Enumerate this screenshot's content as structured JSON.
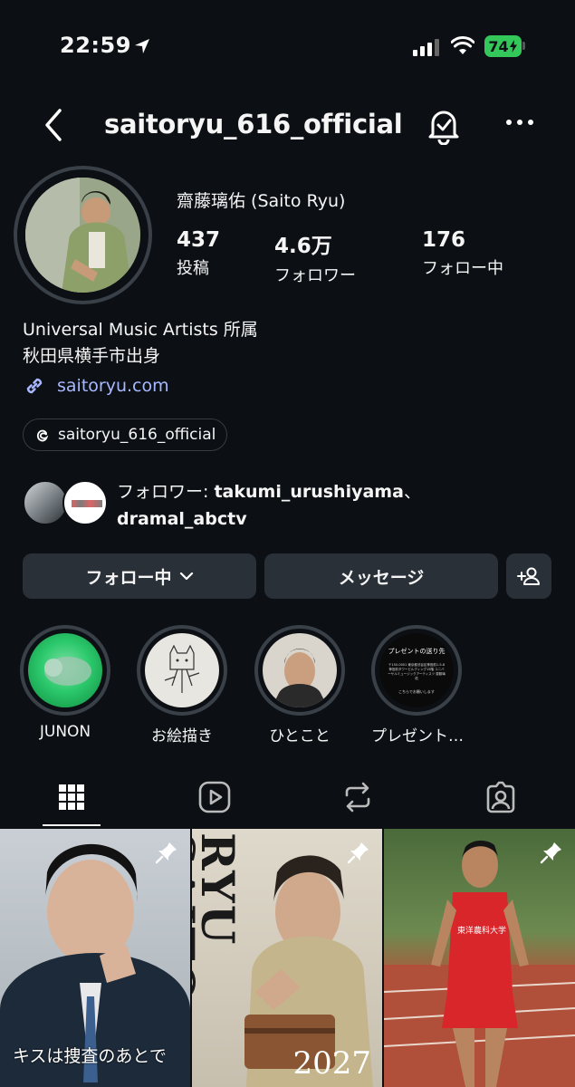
{
  "status_bar": {
    "time": "22:59",
    "battery": "74"
  },
  "header": {
    "username": "saitoryu_616_official"
  },
  "profile": {
    "display_name": "齋藤璃佑 (Saito Ryu)",
    "stats": [
      {
        "num": "437",
        "label": "投稿"
      },
      {
        "num": "4.6万",
        "label": "フォロワー"
      },
      {
        "num": "176",
        "label": "フォロー中"
      }
    ],
    "bio_line1": "Universal Music Artists 所属",
    "bio_line2": "秋田県横手市出身",
    "link": "saitoryu.com",
    "threads": "saitoryu_616_official"
  },
  "mutual": {
    "prefix": "フォロワー: ",
    "user1": "takumi_urushiyama",
    "sep": "、",
    "user2": "dramal_abctv"
  },
  "buttons": {
    "following": "フォロー中",
    "message": "メッセージ"
  },
  "highlights": [
    {
      "label": "JUNON"
    },
    {
      "label": "お絵描き"
    },
    {
      "label": "ひとこと"
    },
    {
      "label": "プレゼント…",
      "card_title": "プレゼントの送り先",
      "card_body": "〒150-0001 東京都渋谷区神宮前1-5-8 神宮前タワービルディング15階 ユニバーサルミュージックアーティスツ 齋藤璃佑",
      "card_footer": "こちらでお願いします"
    }
  ],
  "posts": [
    {
      "caption": "キスは捜査のあとで"
    },
    {
      "vertical_title": "RYU SAITO",
      "year": "2027"
    },
    {
      "jersey": "東洋農科大学"
    }
  ],
  "colors": {
    "link": "#a7b8ff",
    "battery": "#34c759",
    "button_bg": "#2a3038"
  }
}
